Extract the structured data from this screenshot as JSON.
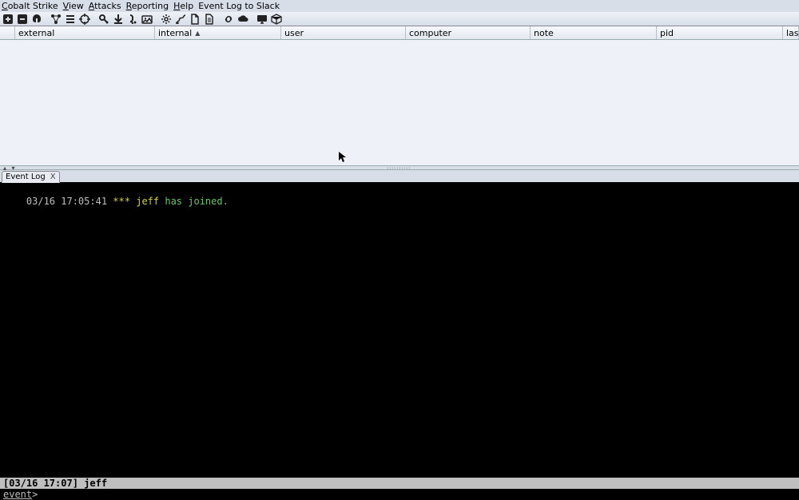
{
  "menu": {
    "items": [
      {
        "label": "Cobalt Strike",
        "ul": 0
      },
      {
        "label": "View",
        "ul": 0
      },
      {
        "label": "Attacks",
        "ul": 0
      },
      {
        "label": "Reporting",
        "ul": 0
      },
      {
        "label": "Help",
        "ul": 0
      },
      {
        "label": "Event Log to Slack",
        "ul": -1
      }
    ]
  },
  "toolbar": {
    "buttons": [
      {
        "name": "connect-icon"
      },
      {
        "name": "disconnect-icon"
      },
      {
        "name": "listeners-icon"
      },
      {
        "sep": true
      },
      {
        "name": "graph-view-icon"
      },
      {
        "name": "list-view-icon"
      },
      {
        "name": "targets-icon"
      },
      {
        "sep": true
      },
      {
        "name": "credentials-icon"
      },
      {
        "name": "downloads-icon"
      },
      {
        "name": "keystrokes-icon"
      },
      {
        "name": "screenshots-icon"
      },
      {
        "sep": true
      },
      {
        "name": "settings-icon"
      },
      {
        "name": "script-console-icon"
      },
      {
        "name": "file-icon"
      },
      {
        "name": "document-icon"
      },
      {
        "sep": true
      },
      {
        "name": "link-icon"
      },
      {
        "name": "cloud-icon"
      },
      {
        "sep": true
      },
      {
        "name": "desktop-icon"
      },
      {
        "name": "package-icon"
      }
    ]
  },
  "columns": {
    "external": "external",
    "internal": "internal",
    "user": "user",
    "computer": "computer",
    "note": "note",
    "pid": "pid",
    "last": "last",
    "sorted": "internal",
    "sort_glyph": "▲"
  },
  "tab": {
    "label": "Event Log",
    "close": "X"
  },
  "log": {
    "timestamp": "03/16 17:05:41",
    "stars": "***",
    "user": "jeff",
    "rest": "has joined."
  },
  "status": "[03/16 17:07] jeff",
  "prompt": {
    "label": "event",
    "gt": ">"
  }
}
